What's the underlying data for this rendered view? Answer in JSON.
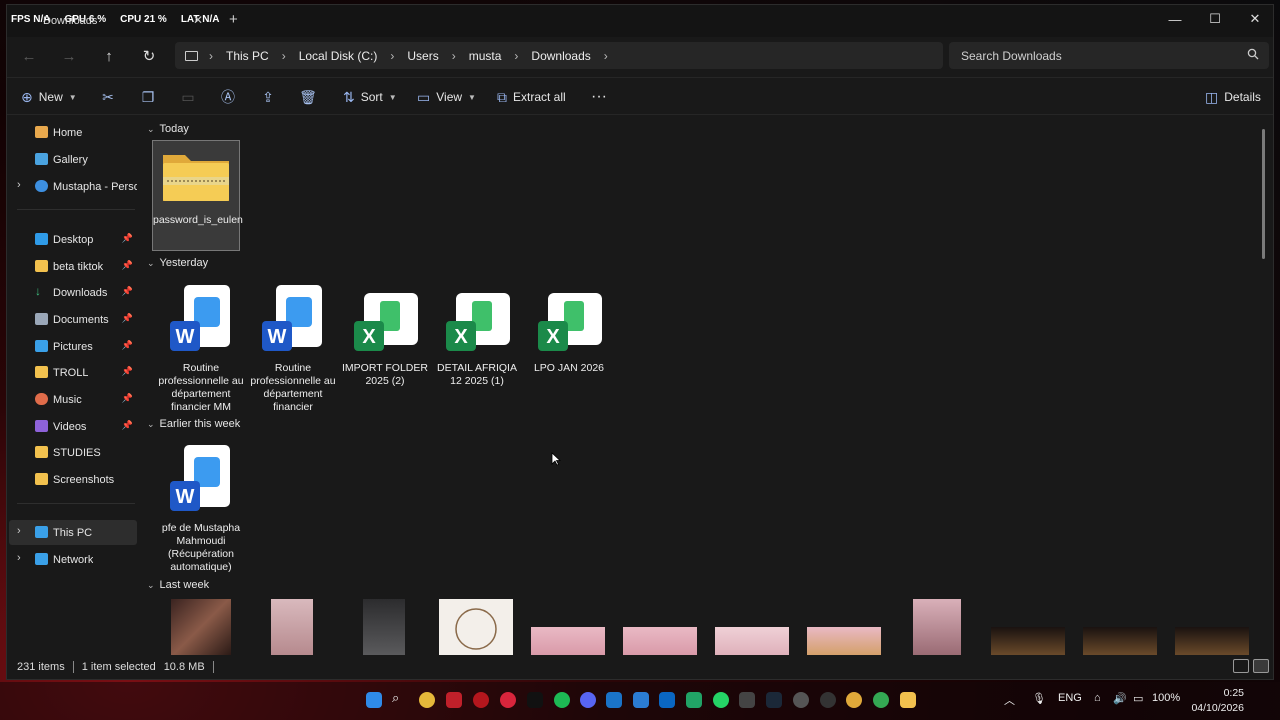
{
  "overlay": {
    "fps": "FPS N/A",
    "gpu": "GPU 6 %",
    "cpu": "CPU 21 %",
    "lat": "LAT N/A"
  },
  "tab": {
    "title": "Downloads"
  },
  "breadcrumbs": [
    "This PC",
    "Local Disk (C:)",
    "Users",
    "musta",
    "Downloads"
  ],
  "search": {
    "placeholder": "Search Downloads"
  },
  "toolbar": {
    "new_label": "New",
    "sort_label": "Sort",
    "view_label": "View",
    "extract_label": "Extract all",
    "details_label": "Details"
  },
  "sidebar": {
    "items": [
      {
        "label": "Home",
        "icon": "home-icon"
      },
      {
        "label": "Gallery",
        "icon": "gallery-icon"
      },
      {
        "label": "Mustapha - Persona",
        "icon": "onedrive-icon"
      },
      {
        "label": "Desktop",
        "icon": "desktop-icon"
      },
      {
        "label": "beta tiktok",
        "icon": "folder-icon"
      },
      {
        "label": "Downloads",
        "icon": "download-icon"
      },
      {
        "label": "Documents",
        "icon": "documents-icon"
      },
      {
        "label": "Pictures",
        "icon": "pictures-icon"
      },
      {
        "label": "TROLL",
        "icon": "folder-icon"
      },
      {
        "label": "Music",
        "icon": "music-icon"
      },
      {
        "label": "Videos",
        "icon": "videos-icon"
      },
      {
        "label": "STUDIES",
        "icon": "folder-icon"
      },
      {
        "label": "Screenshots",
        "icon": "folder-icon"
      },
      {
        "label": "This PC",
        "icon": "pc-icon"
      },
      {
        "label": "Network",
        "icon": "network-icon"
      }
    ]
  },
  "groups": {
    "today": "Today",
    "yesterday": "Yesterday",
    "earlier": "Earlier this week",
    "last_week": "Last week"
  },
  "files": {
    "zip": "password_is_eulen",
    "word1": "Routine professionnelle au département financier MM",
    "word2": "Routine professionnelle au département financier",
    "xls1": "IMPORT FOLDER 2025 (2)",
    "xls2": "DETAIL AFRIQIA 12 2025 (1)",
    "xls3": "LPO JAN 2026",
    "word3": "pfe de Mustapha Mahmoudi (Récupération automatique)"
  },
  "status": {
    "count": "231 items",
    "selected": "1 item selected",
    "size": "10.8 MB"
  },
  "tray": {
    "lang": "ENG",
    "battery": "100%",
    "time": "0:25",
    "date": "04/10/2026"
  },
  "colors": {
    "folder": "#f2c14e",
    "word": "#2b7cd3",
    "excel": "#21a366",
    "accent": "#9ab7f0"
  }
}
